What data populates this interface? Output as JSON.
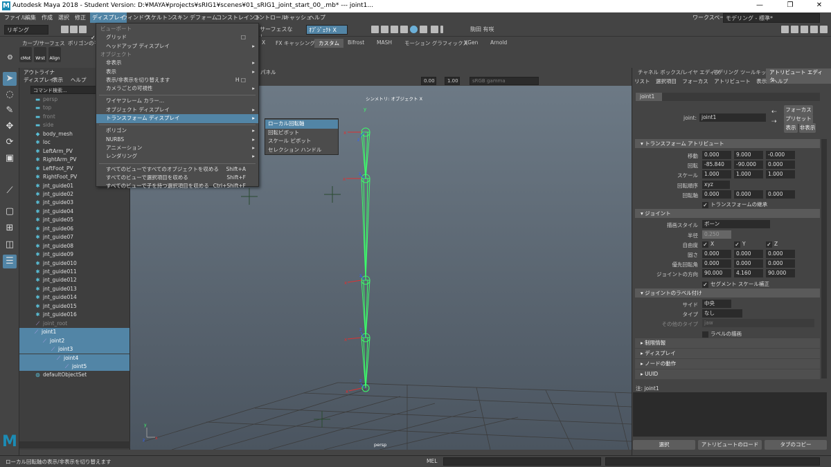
{
  "window": {
    "title": "Autodesk Maya 2018 - Student Version: D:¥MAYA¥projects¥sRIG1¥scenes¥01_sRIG1_joint_start_00_.mb*   ---   joint1..."
  },
  "menubar": [
    "ファイル",
    "編集",
    "作成",
    "選択",
    "修正",
    "ディスプレイ",
    "ウィンドウ",
    "スケルトン",
    "スキン",
    "デフォーム",
    "コンストレイント",
    "コントロール",
    "キャッシュ",
    "ヘルプ"
  ],
  "workspace": {
    "label": "ワークスペース:",
    "value": "モデリング - 標準*"
  },
  "toolbar": {
    "mode": "リギング",
    "surface": "サーフェスなし",
    "object": "ｵﾌﾞｼﾞｪｸﾄ X",
    "user": "駒田 有咲"
  },
  "shelf": {
    "tabs": [
      "カーブ/サーフェス",
      "ポリゴンのモ",
      "X",
      "FX キャッシング",
      "カスタム",
      "Bifrost",
      "MASH",
      "モーション グラフィックス",
      "XGen",
      "Arnold"
    ],
    "icons": [
      "cMot",
      "Wrst",
      "Align"
    ]
  },
  "outliner": {
    "title": "アウトライナ",
    "menu": [
      "ディスプレイ",
      "表示",
      "ヘルプ"
    ],
    "search_placeholder": "コマンド検索...",
    "items": [
      {
        "label": "persp",
        "dim": true
      },
      {
        "label": "top",
        "dim": true
      },
      {
        "label": "front",
        "dim": true
      },
      {
        "label": "side",
        "dim": true
      },
      {
        "label": "body_mesh"
      },
      {
        "label": "loc"
      },
      {
        "label": "LeftArm_PV"
      },
      {
        "label": "RightArm_PV"
      },
      {
        "label": "LeftFoot_PV"
      },
      {
        "label": "RightFoot_PV"
      },
      {
        "label": "jnt_guide01"
      },
      {
        "label": "jnt_guide02"
      },
      {
        "label": "jnt_guide03"
      },
      {
        "label": "jnt_guide04"
      },
      {
        "label": "jnt_guide05"
      },
      {
        "label": "jnt_guide06"
      },
      {
        "label": "jnt_guide07"
      },
      {
        "label": "jnt_guide08"
      },
      {
        "label": "jnt_guide09"
      },
      {
        "label": "jnt_guide010"
      },
      {
        "label": "jnt_guide011"
      },
      {
        "label": "jnt_guide012"
      },
      {
        "label": "jnt_guide013"
      },
      {
        "label": "jnt_guide014"
      },
      {
        "label": "jnt_guide015"
      },
      {
        "label": "jnt_guide016"
      },
      {
        "label": "joint_root",
        "dim": true
      },
      {
        "label": "joint1",
        "sel": true
      },
      {
        "label": "joint2",
        "sel": true
      },
      {
        "label": "joint3",
        "sel": true
      },
      {
        "label": "joint4",
        "sel": true
      },
      {
        "label": "joint5",
        "sel": true
      },
      {
        "label": "defaultObjectSet"
      }
    ]
  },
  "dropdown": {
    "items": [
      {
        "label": "ビューポート",
        "hdr": true
      },
      {
        "label": "グリッド",
        "sc": "□"
      },
      {
        "label": "ヘッドアップ ディスプレイ",
        "ar": "▸"
      },
      {
        "label": "オブジェクト",
        "hdr": true
      },
      {
        "label": "非表示",
        "ar": "▸"
      },
      {
        "label": "表示",
        "ar": "▸"
      },
      {
        "label": "表示/非表示を切り替えます",
        "sc": "H □"
      },
      {
        "label": "カメラごとの可視性",
        "ar": "▸"
      },
      {
        "label": "",
        "hdr": true
      },
      {
        "label": "ワイヤフレーム カラー..."
      },
      {
        "label": "オブジェクト ディスプレイ",
        "ar": "▸"
      },
      {
        "label": "トランスフォーム ディスプレイ",
        "ar": "▸",
        "hl": true
      },
      {
        "label": "",
        "hdr": true
      },
      {
        "label": "ポリゴン",
        "ar": "▸"
      },
      {
        "label": "NURBS",
        "ar": "▸"
      },
      {
        "label": "アニメーション",
        "ar": "▸"
      },
      {
        "label": "レンダリング",
        "ar": "▸"
      },
      {
        "label": "",
        "hdr": true
      },
      {
        "label": "すべてのビューですべてのオブジェクトを収める",
        "sc": "Shift+A"
      },
      {
        "label": "すべてのビューで選択項目を収める",
        "sc": "Shift+F"
      },
      {
        "label": "すべてのビューで子を持つ選択項目を収める",
        "sc": "Ctrl+Shift+F"
      }
    ]
  },
  "submenu": [
    "ローカル回転軸",
    "回転ピボット",
    "スケール ピボット",
    "セレクション ハンドル"
  ],
  "viewport": {
    "menu_label": "パネル",
    "symmetry": "シンメトリ: オブジェクト X",
    "camera": "persp",
    "gamma": "sRGB gamma",
    "val1": "0.00",
    "val2": "1.00"
  },
  "attr": {
    "tabs": [
      "チャネル ボックス/レイヤ エディタ",
      "モデリング ツールキット",
      "アトリビュート エディタ"
    ],
    "menu": [
      "リスト",
      "選択項目",
      "フォーカス",
      "アトリビュート",
      "表示",
      "ヘルプ"
    ],
    "node_tab": "joint1",
    "joint_label": "joint:",
    "joint_value": "joint1",
    "btn_focus": "フォーカス",
    "btn_preset": "プリセット",
    "btn_show": "表示",
    "btn_hide": "非表示",
    "sec_transform": "トランスフォーム アトリビュート",
    "rows": [
      {
        "label": "移動",
        "v": [
          "0.000",
          "9.000",
          "-0.000"
        ]
      },
      {
        "label": "回転",
        "v": [
          "-85.840",
          "-90.000",
          "0.000"
        ]
      },
      {
        "label": "スケール",
        "v": [
          "1.000",
          "1.000",
          "1.000"
        ]
      }
    ],
    "rot_order_label": "回転順序",
    "rot_order": "xyz",
    "rot_axis_label": "回転軸",
    "rot_axis": [
      "0.000",
      "0.000",
      "0.000"
    ],
    "inherit": "トランスフォームの継承",
    "sec_joint": "ジョイント",
    "draw_style_label": "描画スタイル",
    "draw_style": "ボーン",
    "radius_label": "半径",
    "radius": "0.250",
    "dof_label": "自由度",
    "dof": [
      "X",
      "Y",
      "Z"
    ],
    "stiff_label": "固さ",
    "stiff": [
      "0.000",
      "0.000",
      "0.000"
    ],
    "pref_label": "優先回転角",
    "pref": [
      "0.000",
      "0.000",
      "0.000"
    ],
    "orient_label": "ジョイントの方向",
    "orient": [
      "90.000",
      "4.160",
      "90.000"
    ],
    "seg_scale": "セグメント スケール補正",
    "sec_label": "ジョイントのラベル付け",
    "side_label": "サイド",
    "side": "中央",
    "type_label": "タイプ",
    "type": "なし",
    "other_label": "その他のタイプ",
    "other": "jaw",
    "draw_label": "ラベルの描画",
    "collapsed": [
      "制限情報",
      "ディスプレイ",
      "ノードの動作",
      "UUID"
    ],
    "notes": "注:  joint1",
    "bottom": [
      "選択",
      "アトリビュートのロード",
      "タブのコピー"
    ]
  },
  "status": {
    "help": "ローカル回転軸の表示/非表示を切り替えます",
    "mel": "MEL"
  }
}
